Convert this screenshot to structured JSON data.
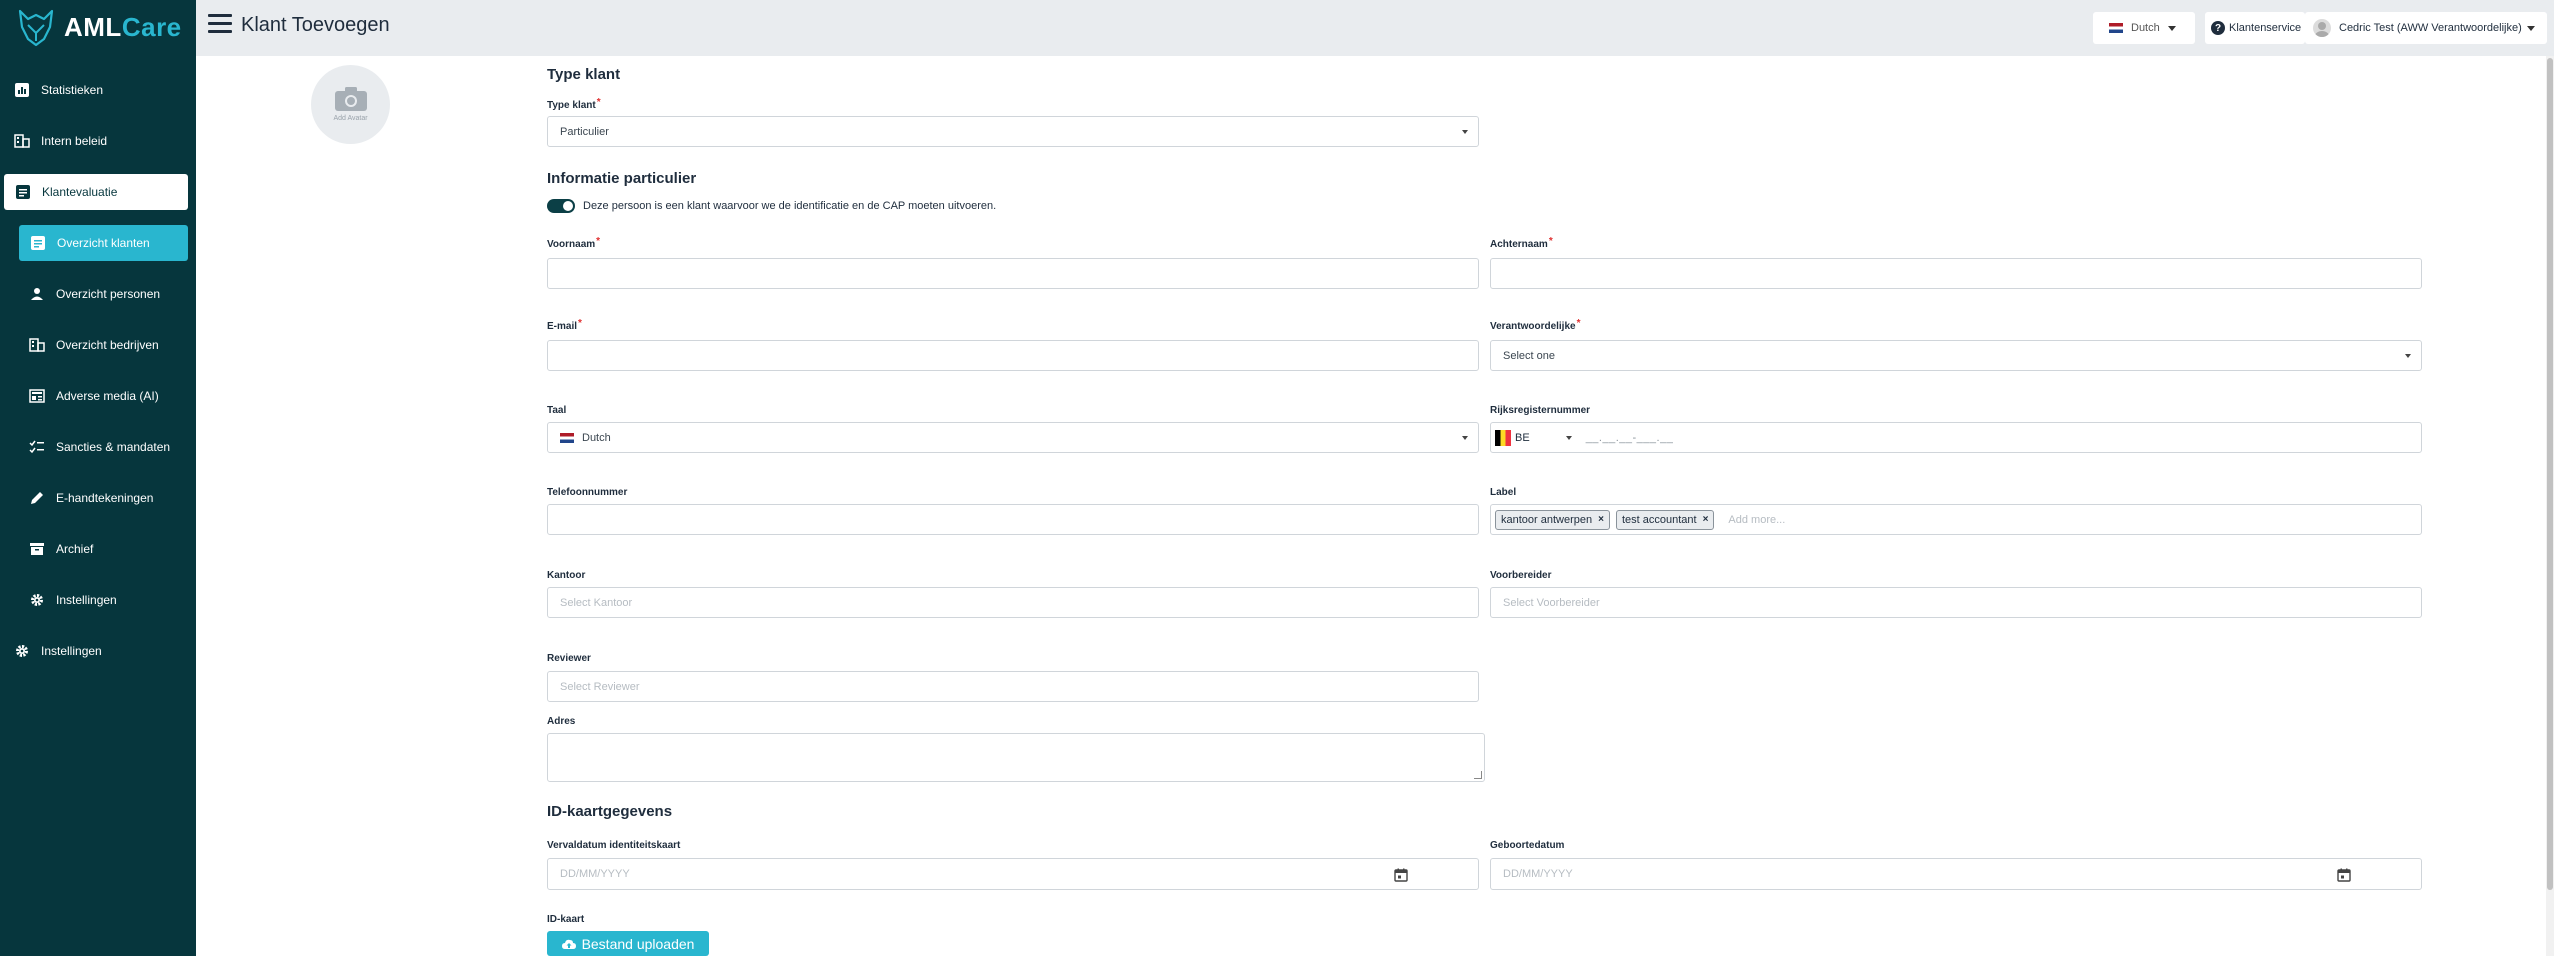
{
  "app": {
    "brand_aml": "AML",
    "brand_care": "Care"
  },
  "header": {
    "title": "Klant Toevoegen",
    "language": "Dutch",
    "support": "Klantenservice",
    "user": "Cedric Test (AWW Verantwoordelijke)"
  },
  "sidebar": {
    "items": [
      {
        "label": "Statistieken",
        "icon": "chart-icon"
      },
      {
        "label": "Intern beleid",
        "icon": "building-icon"
      },
      {
        "label": "Klantevaluatie",
        "icon": "document-icon"
      },
      {
        "label": "Overzicht klanten",
        "icon": "document-icon"
      },
      {
        "label": "Overzicht personen",
        "icon": "person-icon"
      },
      {
        "label": "Overzicht bedrijven",
        "icon": "building-icon"
      },
      {
        "label": "Adverse media (AI)",
        "icon": "newspaper-icon"
      },
      {
        "label": "Sancties & mandaten",
        "icon": "checklist-icon"
      },
      {
        "label": "E-handtekeningen",
        "icon": "pen-icon"
      },
      {
        "label": "Archief",
        "icon": "archive-icon"
      },
      {
        "label": "Instellingen",
        "icon": "gear-icon"
      },
      {
        "label": "Instellingen",
        "icon": "gear-icon"
      }
    ]
  },
  "avatar": {
    "label": "Add Avatar"
  },
  "form": {
    "section_type": "Type klant",
    "type_label": "Type klant",
    "type_value": "Particulier",
    "section_info": "Informatie particulier",
    "toggle_text": "Deze persoon is een klant waarvoor we de identificatie en de CAP moeten uitvoeren.",
    "voornaam_label": "Voornaam",
    "achternaam_label": "Achternaam",
    "email_label": "E-mail",
    "verantwoordelijke_label": "Verantwoordelijke",
    "verantwoordelijke_placeholder": "Select one",
    "taal_label": "Taal",
    "taal_value": "Dutch",
    "rijks_label": "Rijksregisternummer",
    "rijks_country": "BE",
    "rijks_mask": "__.__.__-___.__",
    "telefoon_label": "Telefoonnummer",
    "label_label": "Label",
    "chips": [
      "kantoor antwerpen",
      "test accountant"
    ],
    "chip_remove": "×",
    "add_more": "Add more...",
    "kantoor_label": "Kantoor",
    "kantoor_placeholder": "Select Kantoor",
    "voorbereider_label": "Voorbereider",
    "voorbereider_placeholder": "Select Voorbereider",
    "reviewer_label": "Reviewer",
    "reviewer_placeholder": "Select Reviewer",
    "adres_label": "Adres",
    "section_id": "ID-kaartgegevens",
    "vervaldatum_label": "Vervaldatum identiteitskaart",
    "date_placeholder": "DD/MM/YYYY",
    "geboortedatum_label": "Geboortedatum",
    "idkaart_label": "ID-kaart",
    "upload_label": "Bestand uploaden",
    "required_mark": "*"
  }
}
